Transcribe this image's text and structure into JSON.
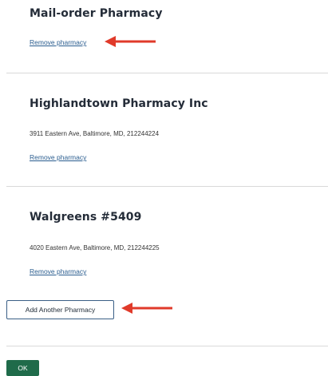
{
  "colors": {
    "link": "#2a5d8f",
    "ok_button": "#1f6b4a",
    "annotation_arrow": "#e03a2a",
    "divider": "#d9d9d9"
  },
  "pharmacies": [
    {
      "name": "Mail-order Pharmacy",
      "address": "",
      "remove_label": "Remove pharmacy"
    },
    {
      "name": "Highlandtown Pharmacy Inc",
      "address": "3911 Eastern Ave, Baltimore, MD, 212244224",
      "remove_label": "Remove pharmacy"
    },
    {
      "name": "Walgreens #5409",
      "address": "4020 Eastern Ave, Baltimore, MD, 212244225",
      "remove_label": "Remove pharmacy"
    }
  ],
  "actions": {
    "add_pharmacy_label": "Add Another Pharmacy",
    "ok_label": "OK"
  },
  "annotations": {
    "arrow_icon": "left-arrow-icon"
  }
}
